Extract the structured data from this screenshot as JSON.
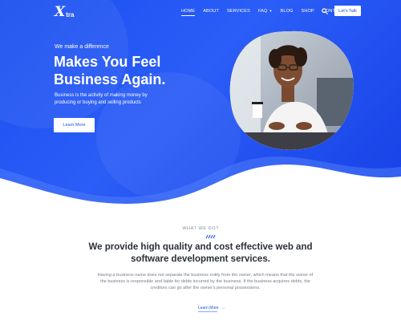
{
  "brand": {
    "logo_mark": "X",
    "logo_text": "tra"
  },
  "nav": {
    "items": [
      {
        "label": "HOME",
        "active": true
      },
      {
        "label": "ABOUT"
      },
      {
        "label": "SERVICES"
      },
      {
        "label": "FAQ"
      },
      {
        "label": "BLOG"
      },
      {
        "label": "SHOP"
      },
      {
        "label": "CONTACT"
      }
    ],
    "cta_label": "Let's Talk",
    "search_icon": "search-icon"
  },
  "hero": {
    "eyebrow": "We make a difference",
    "headline_line1": "Makes You Feel",
    "headline_line2": "Business Again.",
    "lead": "Business is the activity of making money by producing or buying and selling products",
    "button_label": "Learn More"
  },
  "section": {
    "eyebrow": "WHAT WE DO?",
    "title_line1": "We provide high quality and cost effective web and",
    "title_line2": "software development services.",
    "body": "Having a business name does not separate the business entity from the owner, which means that the owner of the business is responsible and liable for debts incurred by the business. If the business acquires debts, the creditors can go after the owner's personal possessions.",
    "link_label": "Learn More",
    "link_icon": "arrow-right-icon"
  },
  "colors": {
    "brand_blue": "#1a4ff0",
    "text_dark": "#2b2f38",
    "text_muted": "#7a7f88"
  }
}
